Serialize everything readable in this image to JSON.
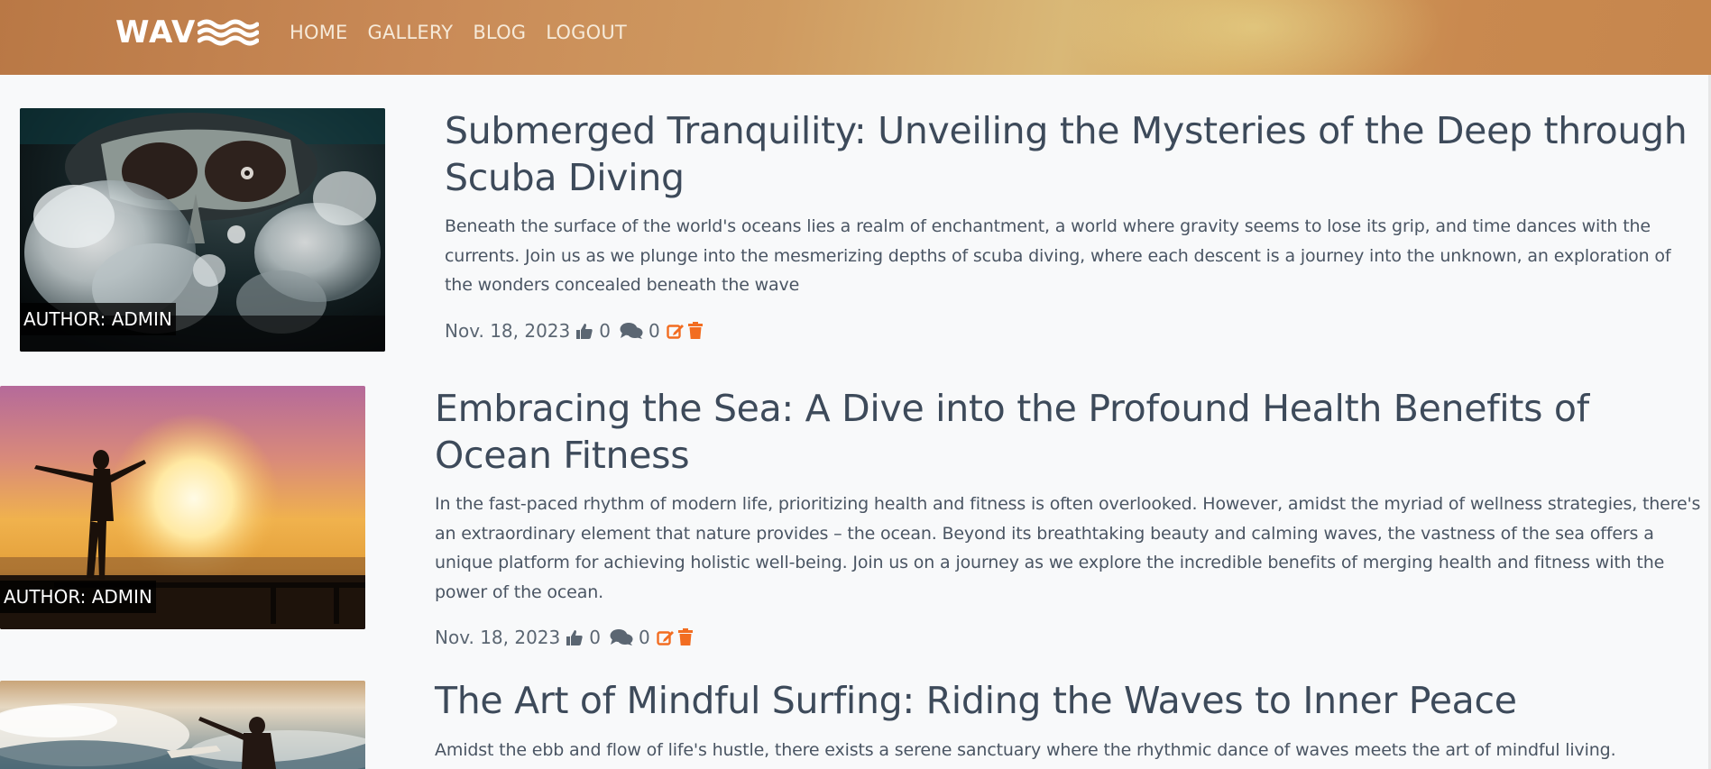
{
  "header": {
    "logo_text": "WAV",
    "nav": [
      "HOME",
      "GALLERY",
      "BLOG",
      "LOGOUT"
    ]
  },
  "posts": [
    {
      "title": "Submerged Tranquility: Unveiling the Mysteries of the Deep through Scuba Diving",
      "excerpt": "Beneath the surface of the world's oceans lies a realm of enchantment, a world where gravity seems to lose its grip, and time dances with the currents. Join us as we plunge into the mesmerizing depths of scuba diving, where each descent is a journey into the unknown, an exploration of the wonders concealed beneath the wave",
      "author": "AUTHOR: ADMIN",
      "date": "Nov. 18, 2023",
      "likes": "0",
      "comments": "0"
    },
    {
      "title": "Embracing the Sea: A Dive into the Profound Health Benefits of Ocean Fitness",
      "excerpt": "In the fast-paced rhythm of modern life, prioritizing health and fitness is often overlooked. However, amidst the myriad of wellness strategies, there's an extraordinary element that nature provides – the ocean. Beyond its breathtaking beauty and calming waves, the vastness of the sea offers a unique platform for achieving holistic well-being. Join us on a journey as we explore the incredible benefits of merging health and fitness with the power of the ocean.",
      "author": "AUTHOR: ADMIN",
      "date": "Nov. 18, 2023",
      "likes": "0",
      "comments": "0"
    },
    {
      "title": "The Art of Mindful Surfing: Riding the Waves to Inner Peace",
      "excerpt": "Amidst the ebb and flow of life's hustle, there exists a serene sanctuary where the rhythmic dance of waves meets the art of mindful living."
    }
  ],
  "icons": {
    "like": "thumbs-up-icon",
    "comment": "comments-icon",
    "edit": "edit-icon",
    "delete": "trash-icon"
  },
  "colors": {
    "accent": "#f26d21",
    "text": "#3d4a5a",
    "meta": "#5b6672",
    "background": "#f8f9fa"
  }
}
